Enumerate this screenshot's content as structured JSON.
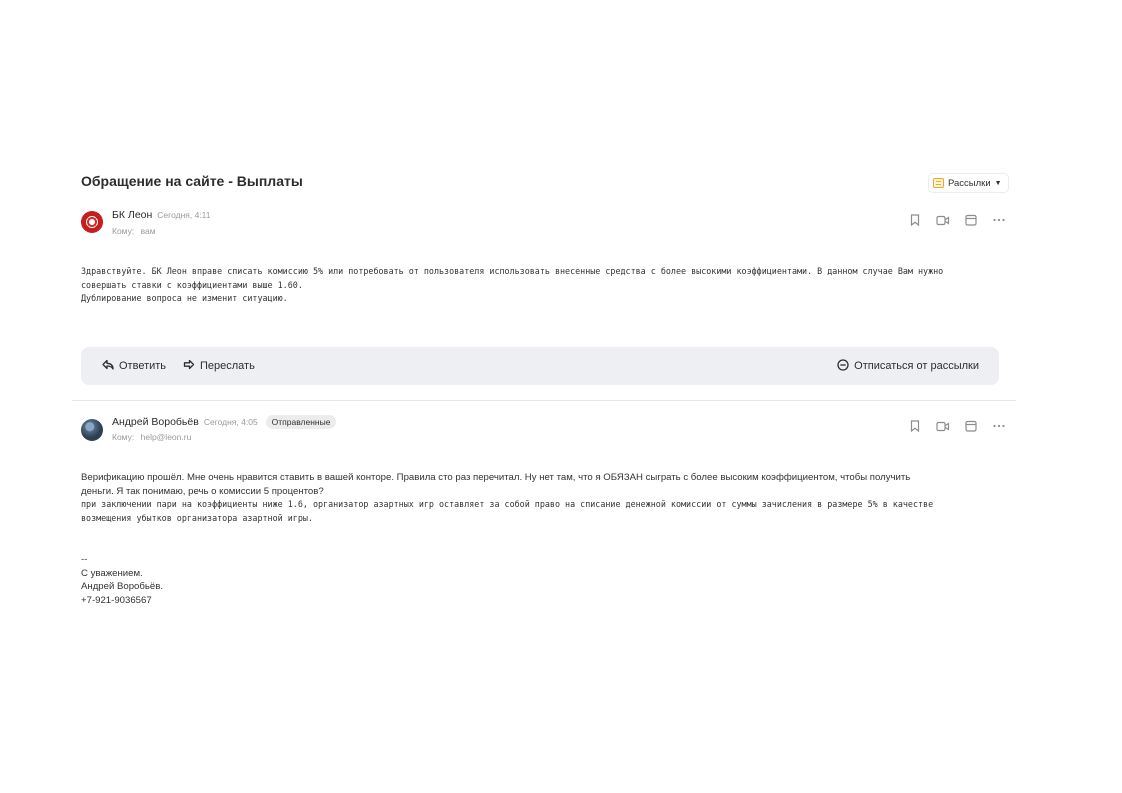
{
  "thread": {
    "subject": "Обращение на сайте - Выплаты",
    "mailing_label": "Рассылки"
  },
  "message1": {
    "sender": "БК Леон",
    "time": "Сегодня, 4:11",
    "to_label": "Кому:",
    "to_value": "вам",
    "body": [
      "Здравствуйте. БК Леон вправе списать комиссию 5% или потребовать от пользователя использовать внесенные средства с более высокими коэффициентами. В данном случае Вам нужно",
      "совершать ставки с коэффициентами выше 1.60.",
      "Дублирование вопроса не изменит ситуацию."
    ]
  },
  "reply_bar": {
    "reply": "Ответить",
    "forward": "Переслать",
    "unsubscribe": "Отписаться от рассылки"
  },
  "message2": {
    "sender": "Андрей Воробьёв",
    "time": "Сегодня, 4:05",
    "tag": "Отправленные",
    "to_label": "Кому:",
    "to_value": "help@leon.ru",
    "body_sans": [
      "Верификацию прошёл. Мне очень нравится ставить в вашей конторе. Правила сто раз перечитал. Ну нет там, что я ОБЯЗАН сыграть с более высоким коэффициентом, чтобы получить",
      "деньги. Я так понимаю, речь о комиссии 5 процентов?"
    ],
    "body_mono": [
      "при заключении пари на коэффициенты ниже 1.6, организатор азартных игр оставляет за собой право на списание денежной комиссии от суммы зачисления в размере 5% в качестве",
      "возмещения убытков организатора азартной игры."
    ],
    "signature": [
      "--",
      "С уважением.",
      "Андрей Воробьёв.",
      "+7-921-9036567"
    ]
  },
  "colors": {
    "accent_mailing": "#f5a623",
    "reply_bar_bg": "#eeeff2",
    "tag_bg": "#ececec"
  },
  "icons": [
    "bookmark-icon",
    "video-call-icon",
    "calendar-icon",
    "more-icon",
    "reply-icon",
    "forward-icon",
    "unsubscribe-icon",
    "mailing-icon",
    "chevron-down-icon"
  ]
}
